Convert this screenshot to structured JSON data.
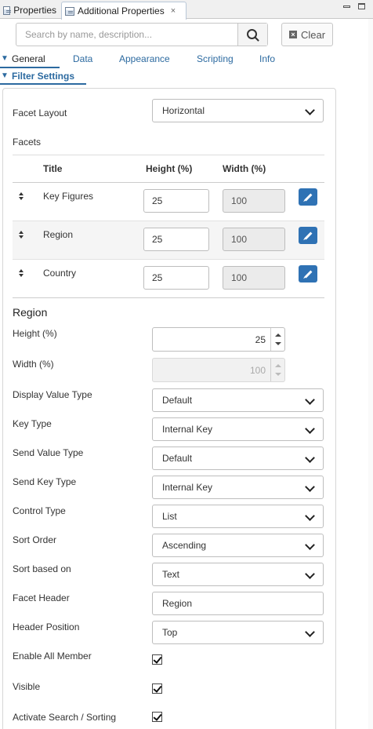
{
  "tabs": {
    "properties": "Properties",
    "additional": "Additional Properties",
    "close": "×"
  },
  "search": {
    "placeholder": "Search by name, description...",
    "clear_label": "Clear"
  },
  "categories": [
    "General",
    "Data",
    "Appearance",
    "Scripting",
    "Info"
  ],
  "section": {
    "title": "Filter Settings"
  },
  "facet_layout": {
    "label": "Facet Layout",
    "value": "Horizontal"
  },
  "facets": {
    "label": "Facets",
    "columns": {
      "title": "Title",
      "height": "Height (%)",
      "width": "Width (%)"
    },
    "rows": [
      {
        "title": "Key Figures",
        "height": "25",
        "width": "100"
      },
      {
        "title": "Region",
        "height": "25",
        "width": "100"
      },
      {
        "title": "Country",
        "height": "25",
        "width": "100"
      }
    ]
  },
  "region": {
    "heading": "Region",
    "height": {
      "label": "Height (%)",
      "value": "25"
    },
    "width": {
      "label": "Width (%)",
      "value": "100"
    },
    "display_value_type": {
      "label": "Display Value Type",
      "value": "Default"
    },
    "key_type": {
      "label": "Key Type",
      "value": "Internal Key"
    },
    "send_value_type": {
      "label": "Send Value Type",
      "value": "Default"
    },
    "send_key_type": {
      "label": "Send Key Type",
      "value": "Internal Key"
    },
    "control_type": {
      "label": "Control Type",
      "value": "List"
    },
    "sort_order": {
      "label": "Sort Order",
      "value": "Ascending"
    },
    "sort_based_on": {
      "label": "Sort based on",
      "value": "Text"
    },
    "facet_header": {
      "label": "Facet Header",
      "value": "Region"
    },
    "header_position": {
      "label": "Header Position",
      "value": "Top"
    },
    "enable_all_member": {
      "label": "Enable All Member",
      "checked": true
    },
    "visible": {
      "label": "Visible",
      "checked": true
    },
    "activate_search": {
      "label": "Activate Search / Sorting",
      "checked": true
    }
  },
  "colors": {
    "accent": "#2c6aa0",
    "edit_button": "#2f72b4"
  }
}
